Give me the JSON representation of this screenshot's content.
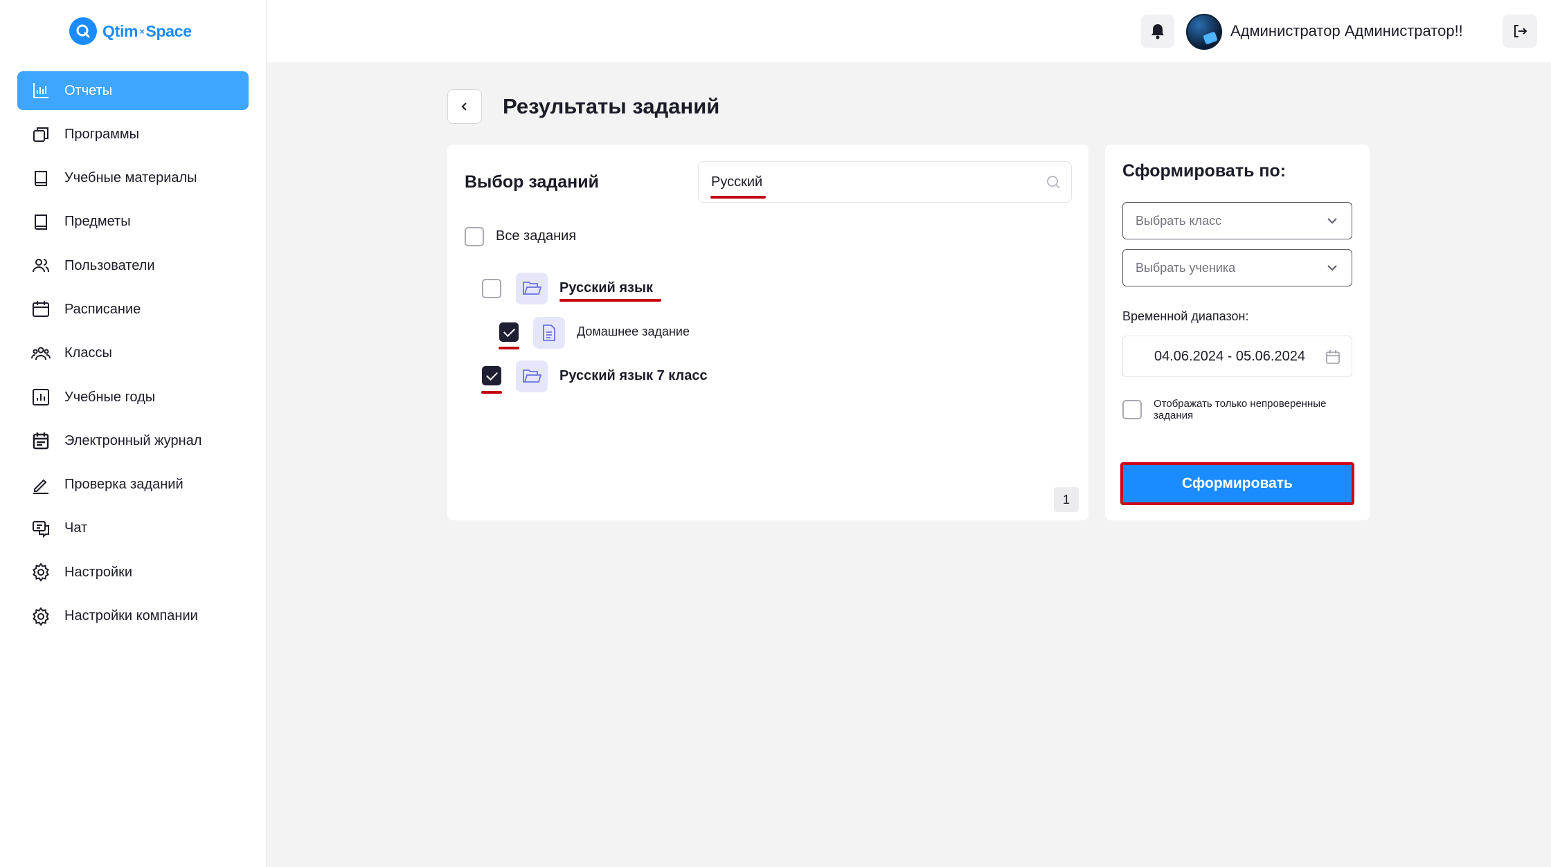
{
  "brand": {
    "left": "Qtim",
    "sep": "×",
    "right": "Space"
  },
  "sidebar": {
    "items": [
      {
        "label": "Отчеты",
        "icon": "chart-icon",
        "active": true
      },
      {
        "label": "Программы",
        "icon": "copy-icon"
      },
      {
        "label": "Учебные материалы",
        "icon": "book-icon"
      },
      {
        "label": "Предметы",
        "icon": "book-icon"
      },
      {
        "label": "Пользователи",
        "icon": "users-icon"
      },
      {
        "label": "Расписание",
        "icon": "calendar-icon"
      },
      {
        "label": "Классы",
        "icon": "group-icon"
      },
      {
        "label": "Учебные годы",
        "icon": "report-icon"
      },
      {
        "label": "Электронный журнал",
        "icon": "journal-icon"
      },
      {
        "label": "Проверка заданий",
        "icon": "edit-icon"
      },
      {
        "label": "Чат",
        "icon": "chat-icon"
      },
      {
        "label": "Настройки",
        "icon": "gear-icon"
      },
      {
        "label": "Настройки компании",
        "icon": "gear-icon"
      }
    ]
  },
  "header": {
    "username": "Администратор Администратор!!"
  },
  "page": {
    "title": "Результаты заданий"
  },
  "tasks": {
    "title": "Выбор заданий",
    "search_value": "Русский",
    "all_label": "Все задания",
    "items": [
      {
        "label": "Русский язык",
        "checked": false,
        "type": "folder"
      },
      {
        "label": "Домашнее задание",
        "checked": true,
        "type": "document"
      },
      {
        "label": "Русский язык 7 класс",
        "checked": true,
        "type": "folder"
      }
    ],
    "page": "1"
  },
  "form": {
    "title": "Сформировать по:",
    "class_placeholder": "Выбрать класс",
    "student_placeholder": "Выбрать ученика",
    "range_label": "Временной диапазон:",
    "date_range": "04.06.2024 - 05.06.2024",
    "only_unchecked_label": "Отображать только непроверенные задания",
    "submit_label": "Сформировать"
  },
  "colors": {
    "accent": "#1a8cff",
    "active_nav": "#3ea6ff",
    "highlight": "#d0021b"
  }
}
